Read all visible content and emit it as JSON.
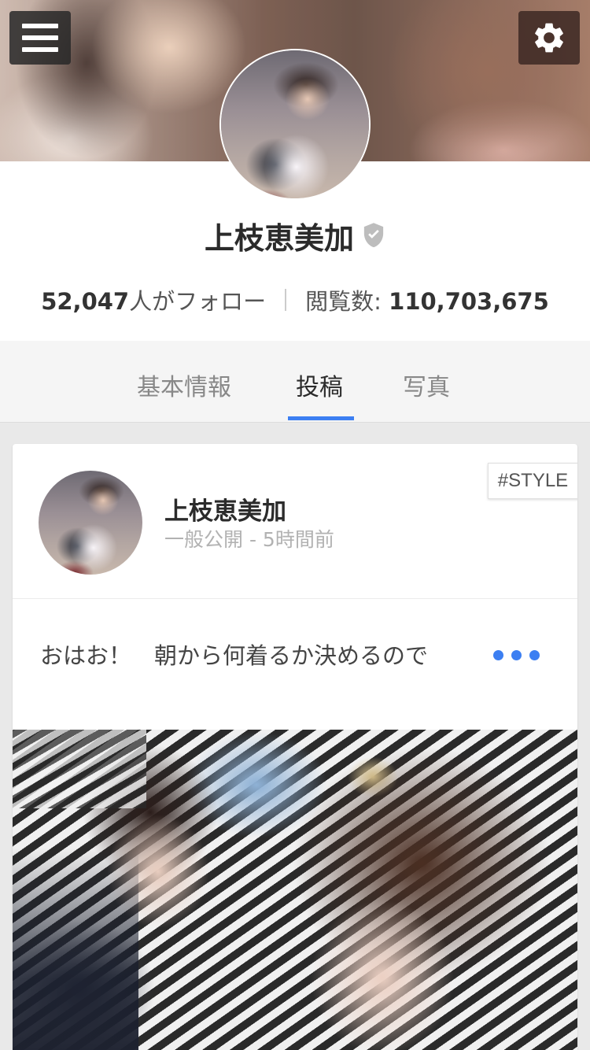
{
  "header": {
    "menu_icon": "hamburger-menu-icon",
    "settings_icon": "gear-icon"
  },
  "profile": {
    "name": "上枝恵美加",
    "verified_icon": "verified-shield-icon",
    "followers_count": "52,047",
    "followers_label": "人がフォロー",
    "views_label": "閲覧数:",
    "views_count": "110,703,675"
  },
  "tabs": [
    {
      "label": "基本情報",
      "active": false
    },
    {
      "label": "投稿",
      "active": true
    },
    {
      "label": "写真",
      "active": false
    }
  ],
  "colors": {
    "accent": "#3c7ff2",
    "text_dark": "#2b2b2b",
    "text_muted": "#b2b2b2"
  },
  "post": {
    "author": "上枝恵美加",
    "meta": "一般公開 - 5時間前",
    "tag": "#STYLE",
    "text": "おはお！　朝から何着るか決めるので",
    "more_icon": "more-dots-icon"
  }
}
